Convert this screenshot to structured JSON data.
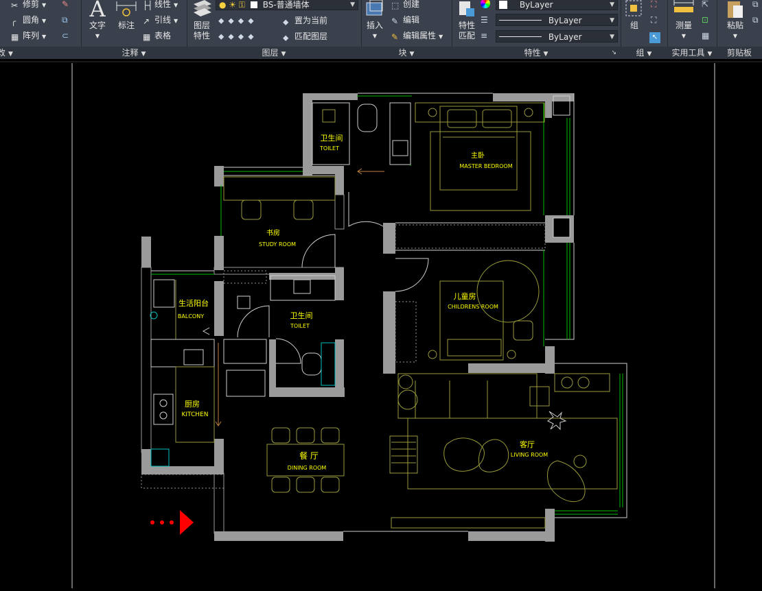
{
  "ribbon": {
    "modify": {
      "trim": "修剪",
      "fillet": "圆角",
      "array": "阵列",
      "panel_label": "改"
    },
    "annotation": {
      "text": "文字",
      "dimension": "标注",
      "linetype": "线性",
      "leader": "引线",
      "table": "表格",
      "panel_label": "注释"
    },
    "layers": {
      "layer_properties_line1": "图层",
      "layer_properties_line2": "特性",
      "current_layer": "BS-普通墙体",
      "set_current": "置为当前",
      "match_layer": "匹配图层",
      "panel_label": "图层"
    },
    "block": {
      "insert": "插入",
      "create": "创建",
      "edit": "编辑",
      "edit_attributes": "编辑属性",
      "panel_label": "块"
    },
    "properties": {
      "match_line1": "特性",
      "match_line2": "匹配",
      "color": "ByLayer",
      "linetype": "ByLayer",
      "lineweight": "ByLayer",
      "panel_label": "特性"
    },
    "groups": {
      "group": "组",
      "panel_label": "组"
    },
    "utilities": {
      "measure": "测量",
      "panel_label": "实用工具"
    },
    "clipboard": {
      "paste": "粘贴",
      "panel_label": "剪贴板"
    }
  },
  "drawing": {
    "rooms": [
      {
        "cn": "卫生间",
        "en": "TOILET"
      },
      {
        "cn": "主卧",
        "en": "MASTER BEDROOM"
      },
      {
        "cn": "书房",
        "en": "STUDY ROOM"
      },
      {
        "cn": "生活阳台",
        "en": "BALCONY"
      },
      {
        "cn": "卫生间",
        "en": "TOILET"
      },
      {
        "cn": "儿童房",
        "en": "CHILDRENS ROOM"
      },
      {
        "cn": "厨房",
        "en": "KITCHEN"
      },
      {
        "cn": "餐  厅",
        "en": "DINING ROOM"
      },
      {
        "cn": "客厅",
        "en": "LIVING ROOM"
      }
    ],
    "colors": {
      "wall": "#9a9a9a",
      "furniture": "#9a9a3a",
      "label": "#ffff00",
      "window": "#00c000",
      "entry_arrow": "#ff0000"
    }
  }
}
